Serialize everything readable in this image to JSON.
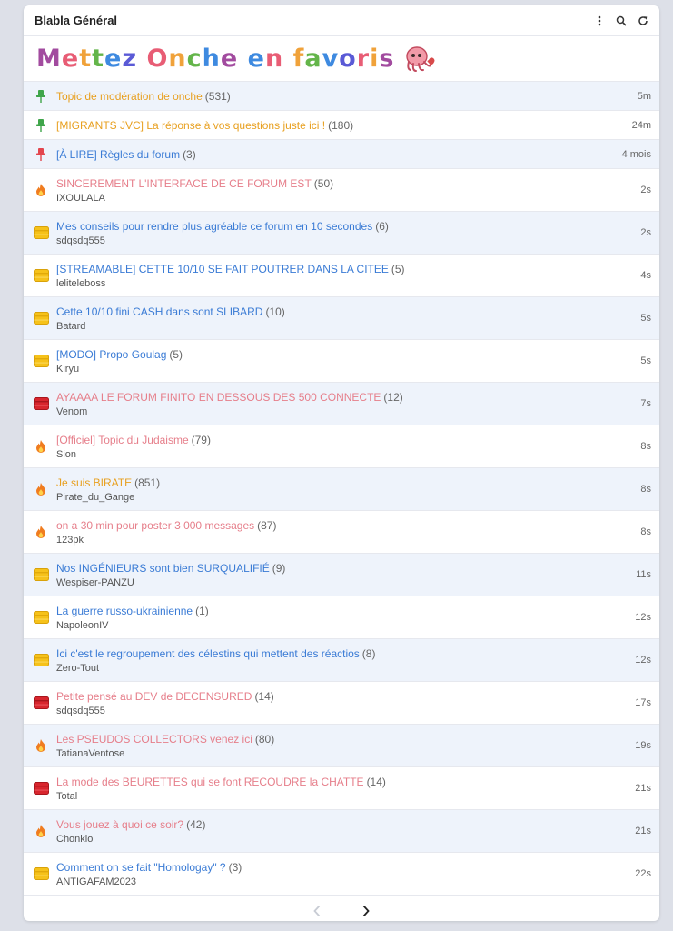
{
  "header": {
    "title": "Blabla Général"
  },
  "banner": {
    "letters": [
      {
        "ch": "M",
        "color": "#a24b9f"
      },
      {
        "ch": "e",
        "color": "#e85d75"
      },
      {
        "ch": "t",
        "color": "#f0a23a"
      },
      {
        "ch": "t",
        "color": "#64b54a"
      },
      {
        "ch": "e",
        "color": "#3e8ae0"
      },
      {
        "ch": "z",
        "color": "#5a5ad6"
      },
      {
        "ch": " ",
        "color": "#000000"
      },
      {
        "ch": "O",
        "color": "#e85d75"
      },
      {
        "ch": "n",
        "color": "#f0a23a"
      },
      {
        "ch": "c",
        "color": "#64b54a"
      },
      {
        "ch": "h",
        "color": "#3e8ae0"
      },
      {
        "ch": "e",
        "color": "#a24b9f"
      },
      {
        "ch": " ",
        "color": "#000000"
      },
      {
        "ch": "e",
        "color": "#3e8ae0"
      },
      {
        "ch": "n",
        "color": "#e85d75"
      },
      {
        "ch": " ",
        "color": "#000000"
      },
      {
        "ch": "f",
        "color": "#f0a23a"
      },
      {
        "ch": "a",
        "color": "#64b54a"
      },
      {
        "ch": "v",
        "color": "#3e8ae0"
      },
      {
        "ch": "o",
        "color": "#5a5ad6"
      },
      {
        "ch": "r",
        "color": "#e85d75"
      },
      {
        "ch": "i",
        "color": "#f0a23a"
      },
      {
        "ch": "s",
        "color": "#a24b9f"
      }
    ]
  },
  "topics": [
    {
      "icon": "pin-green",
      "title": "Topic de modération de onche",
      "count": "(531)",
      "author": "",
      "time": "5m",
      "color": "orange"
    },
    {
      "icon": "pin-green",
      "title": "[MIGRANTS JVC] La réponse à vos questions juste ici !",
      "count": "(180)",
      "author": "",
      "time": "24m",
      "color": "orange"
    },
    {
      "icon": "pin-red",
      "title": "[À LIRE] Règles du forum",
      "count": "(3)",
      "author": "",
      "time": "4 mois",
      "color": "blue"
    },
    {
      "icon": "fire",
      "title": "SINCEREMENT L'INTERFACE DE CE FORUM EST",
      "count": "(50)",
      "author": "IXOULALA",
      "time": "2s",
      "color": "pink"
    },
    {
      "icon": "folder-yellow",
      "title": "Mes conseils pour rendre plus agréable ce forum en 10 secondes",
      "count": "(6)",
      "author": "sdqsdq555",
      "time": "2s",
      "color": "blue"
    },
    {
      "icon": "folder-yellow",
      "title": "[STREAMABLE] CETTE 10/10 SE FAIT POUTRER DANS LA CITEE",
      "count": "(5)",
      "author": "leliteleboss",
      "time": "4s",
      "color": "blue"
    },
    {
      "icon": "folder-yellow",
      "title": "Cette 10/10 fini CASH dans sont SLIBARD",
      "count": "(10)",
      "author": "Batard",
      "time": "5s",
      "color": "blue"
    },
    {
      "icon": "folder-yellow",
      "title": "[MODO] Propo Goulag",
      "count": "(5)",
      "author": "Kiryu",
      "time": "5s",
      "color": "blue"
    },
    {
      "icon": "folder-red",
      "title": "AYAAAA LE FORUM FINITO EN DESSOUS DES 500 CONNECTE",
      "count": "(12)",
      "author": "Venom",
      "time": "7s",
      "color": "pink"
    },
    {
      "icon": "fire",
      "title": "[Officiel] Topic du Judaisme",
      "count": "(79)",
      "author": "Sion",
      "time": "8s",
      "color": "pink"
    },
    {
      "icon": "fire",
      "title": "Je suis BIRATE",
      "count": "(851)",
      "author": "Pirate_du_Gange",
      "time": "8s",
      "color": "orange"
    },
    {
      "icon": "fire",
      "title": "on a 30 min pour poster 3 000 messages",
      "count": "(87)",
      "author": "123pk",
      "time": "8s",
      "color": "pink"
    },
    {
      "icon": "folder-yellow",
      "title": "Nos INGÉNIEURS sont bien SURQUALIFIÉ",
      "count": "(9)",
      "author": "Wespiser-PANZU",
      "time": "11s",
      "color": "blue"
    },
    {
      "icon": "folder-yellow",
      "title": "La guerre russo-ukrainienne",
      "count": "(1)",
      "author": "NapoleonIV",
      "time": "12s",
      "color": "blue"
    },
    {
      "icon": "folder-yellow",
      "title": "Ici c'est le regroupement des célestins qui mettent des réactios",
      "count": "(8)",
      "author": "Zero-Tout",
      "time": "12s",
      "color": "blue"
    },
    {
      "icon": "folder-red",
      "title": "Petite pensé au DEV de DECENSURED",
      "count": "(14)",
      "author": "sdqsdq555",
      "time": "17s",
      "color": "pink"
    },
    {
      "icon": "fire",
      "title": "Les PSEUDOS COLLECTORS venez ici",
      "count": "(80)",
      "author": "TatianaVentose",
      "time": "19s",
      "color": "pink"
    },
    {
      "icon": "folder-red",
      "title": "La mode des BEURETTES qui se font RECOUDRE la CHATTE",
      "count": "(14)",
      "author": "Total",
      "time": "21s",
      "color": "pink"
    },
    {
      "icon": "fire",
      "title": "Vous jouez à quoi ce soir?",
      "count": "(42)",
      "author": "Chonklo",
      "time": "21s",
      "color": "pink"
    },
    {
      "icon": "folder-yellow",
      "title": "Comment on se fait \"Homologay\" ?",
      "count": "(3)",
      "author": "ANTIGAFAM2023",
      "time": "22s",
      "color": "blue"
    }
  ],
  "icons": {
    "menu": "more-vertical-icon",
    "search": "search-icon",
    "refresh": "refresh-icon",
    "prev": "chevron-left-icon",
    "next": "chevron-right-icon"
  }
}
